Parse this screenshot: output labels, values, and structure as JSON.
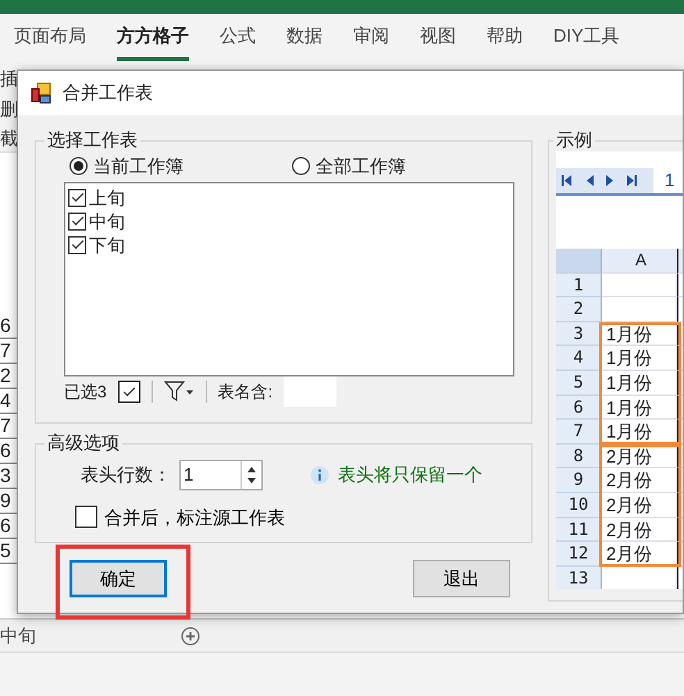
{
  "ribbon_tabs": [
    {
      "label": "页面布局",
      "selected": false
    },
    {
      "label": "方方格子",
      "selected": true
    },
    {
      "label": "公式",
      "selected": false
    },
    {
      "label": "数据",
      "selected": false
    },
    {
      "label": "审阅",
      "selected": false
    },
    {
      "label": "视图",
      "selected": false
    },
    {
      "label": "帮助",
      "selected": false
    },
    {
      "label": "DIY工具",
      "selected": false
    }
  ],
  "sheet_background": {
    "toolbar_fragments": [
      "插",
      "删",
      "截"
    ],
    "column_cells": [
      "6",
      "7",
      "2",
      "4",
      "7",
      "6",
      "3",
      "9",
      "6",
      "5"
    ],
    "sheet_tabs": [
      {
        "label": "中旬",
        "selected": false
      }
    ]
  },
  "dialog": {
    "title": "合并工作表",
    "select_group": {
      "title": "选择工作表",
      "scope_options": [
        {
          "label": "当前工作簿",
          "selected": true
        },
        {
          "label": "全部工作簿",
          "selected": false
        }
      ],
      "sheets": [
        {
          "label": "上旬",
          "checked": true
        },
        {
          "label": "中旬",
          "checked": true
        },
        {
          "label": "下旬",
          "checked": true
        }
      ],
      "selected_count": "已选3",
      "select_all_checked": true,
      "name_filter_label": "表名含:"
    },
    "advanced_group": {
      "title": "高级选项",
      "header_rows_label": "表头行数：",
      "header_rows_value": "1",
      "hint": "表头将只保留一个",
      "mark_source": {
        "label": "合并后，标注源工作表",
        "checked": false
      }
    },
    "buttons": [
      {
        "label": "确定",
        "focused": true,
        "highlighted": true
      },
      {
        "label": "退出",
        "focused": false,
        "highlighted": false
      }
    ],
    "example": {
      "title": "示例",
      "sheet_tab": "1",
      "column_header": "A",
      "rows_before": [
        {
          "number": "1"
        },
        {
          "number": "2"
        }
      ],
      "highlighted_blocks": [
        {
          "color": "#f0893a",
          "rows": [
            {
              "number": "3",
              "value": "1月份"
            },
            {
              "number": "4",
              "value": "1月份"
            },
            {
              "number": "5",
              "value": "1月份"
            },
            {
              "number": "6",
              "value": "1月份"
            },
            {
              "number": "7",
              "value": "1月份"
            }
          ]
        },
        {
          "color": "#f0893a",
          "rows": [
            {
              "number": "8",
              "value": "2月份"
            },
            {
              "number": "9",
              "value": "2月份"
            },
            {
              "number": "10",
              "value": "2月份"
            },
            {
              "number": "11",
              "value": "2月份"
            },
            {
              "number": "12",
              "value": "2月份"
            }
          ]
        }
      ],
      "rows_after": [
        {
          "number": "13"
        }
      ]
    }
  }
}
